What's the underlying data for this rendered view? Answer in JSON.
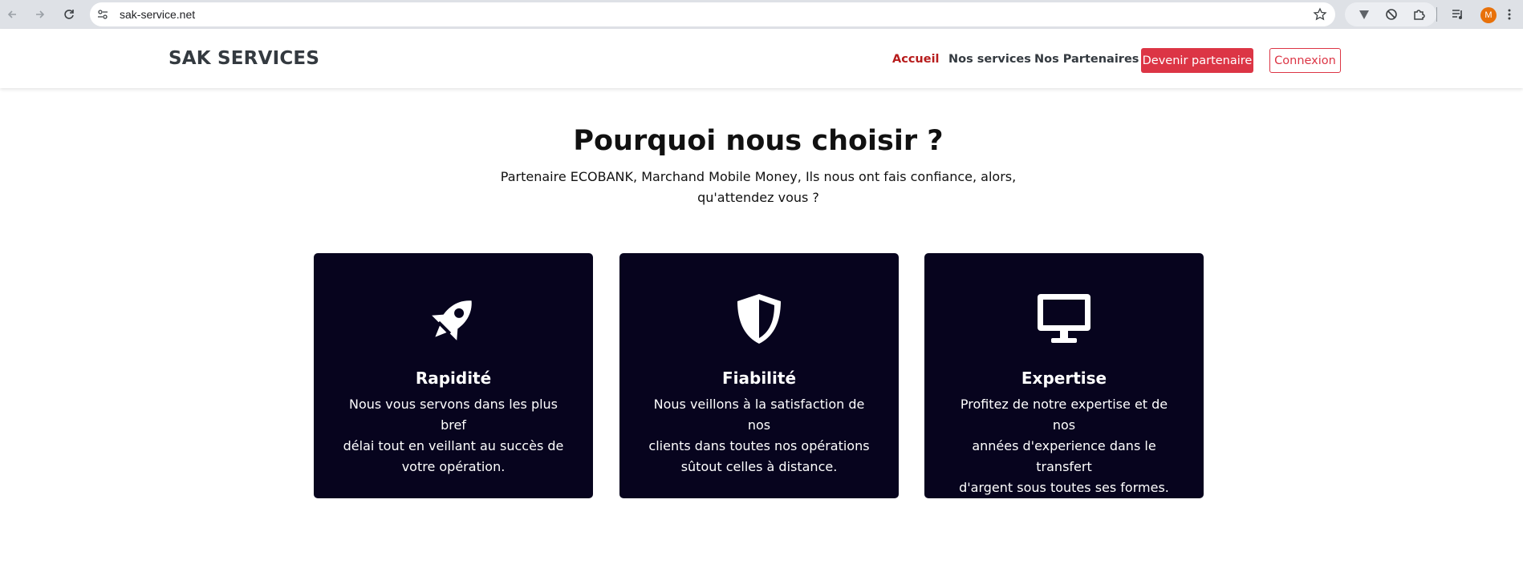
{
  "browser": {
    "url": "sak-service.net",
    "profile_initial": "M"
  },
  "header": {
    "brand": "SAK SERVICES",
    "nav": {
      "home": "Accueil",
      "services": "Nos services",
      "partners": "Nos Partenaires"
    },
    "become_partner": "Devenir partenaire",
    "login": "Connexion"
  },
  "section": {
    "title": "Pourquoi nous choisir ?",
    "subtitle_line1": "Partenaire ECOBANK, Marchand Mobile Money, Ils nous ont fais confiance, alors,",
    "subtitle_line2": "qu'attendez vous ?"
  },
  "cards": [
    {
      "icon": "rocket-icon",
      "title": "Rapidité",
      "lines": [
        "Nous vous servons dans les plus bref",
        "délai tout en veillant au succès de",
        "votre opération."
      ]
    },
    {
      "icon": "shield-icon",
      "title": "Fiabilité",
      "lines": [
        "Nous veillons à la satisfaction de nos",
        "clients dans toutes nos opérations",
        "sûtout celles à distance."
      ]
    },
    {
      "icon": "monitor-icon",
      "title": "Expertise",
      "lines": [
        "Profitez de notre expertise et de nos",
        "années d'experience dans le transfert",
        "d'argent sous toutes ses formes."
      ]
    }
  ],
  "colors": {
    "accent": "#dc3545",
    "active_nav": "#b71c1c",
    "card_bg": "#07041e",
    "brand_text": "#343a40"
  }
}
